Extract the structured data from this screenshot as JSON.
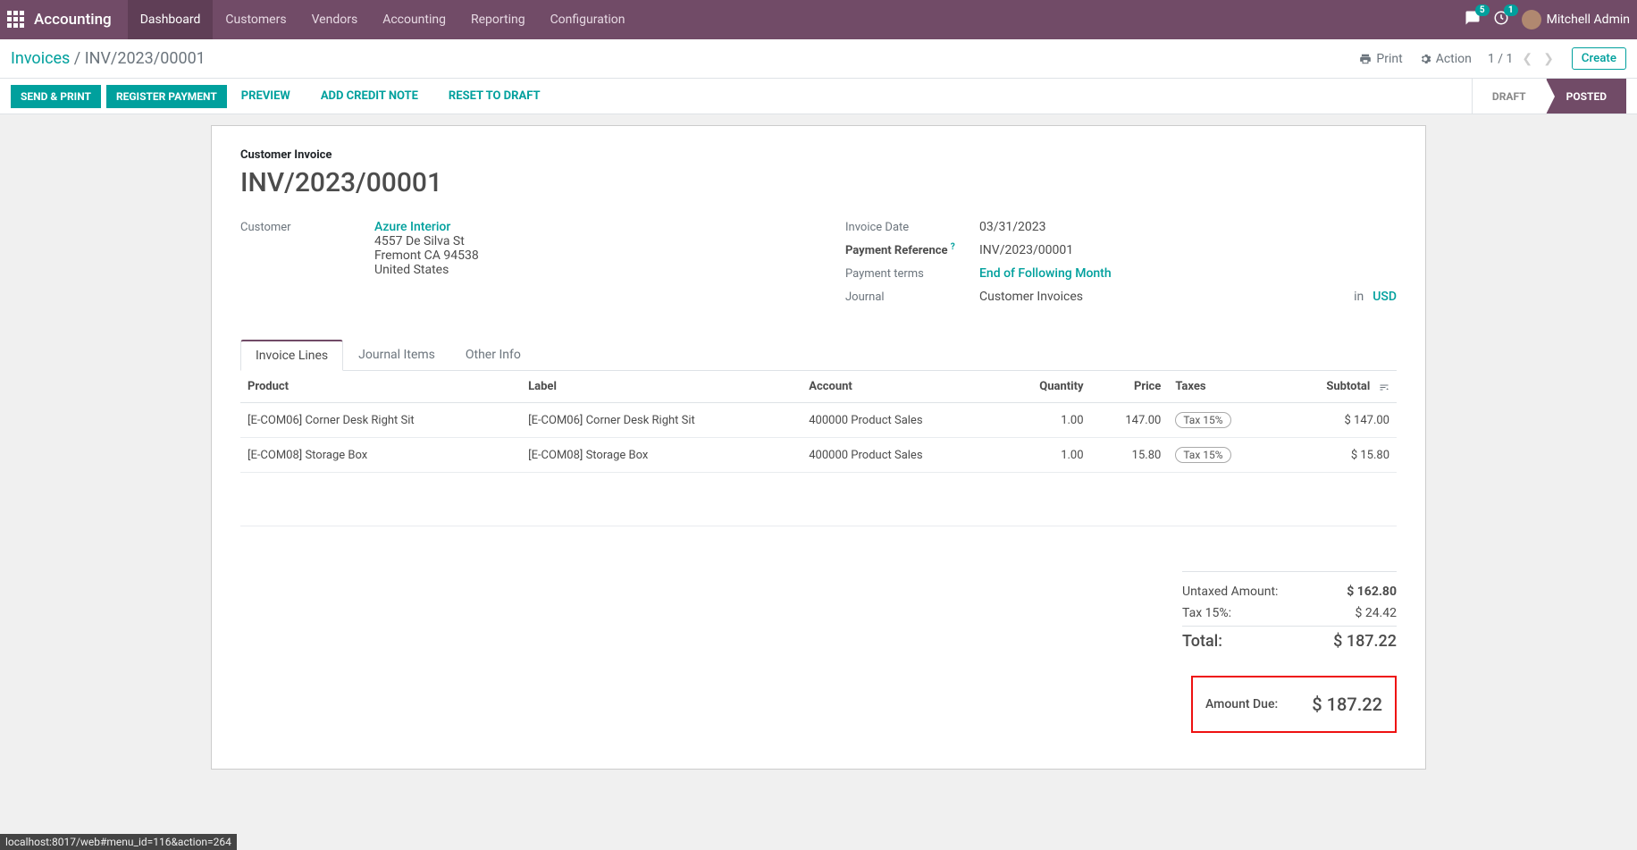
{
  "nav": {
    "brand": "Accounting",
    "items": [
      "Dashboard",
      "Customers",
      "Vendors",
      "Accounting",
      "Reporting",
      "Configuration"
    ],
    "activeIndex": 0,
    "messagesBadge": "5",
    "activitiesBadge": "1",
    "user": "Mitchell Admin"
  },
  "controlBar": {
    "breadcrumbRoot": "Invoices",
    "breadcrumbCurrent": "INV/2023/00001",
    "printLabel": "Print",
    "actionLabel": "Action",
    "pager": "1 / 1",
    "createLabel": "Create"
  },
  "statusBar": {
    "buttons": {
      "sendPrint": "SEND & PRINT",
      "registerPayment": "REGISTER PAYMENT",
      "preview": "PREVIEW",
      "addCreditNote": "ADD CREDIT NOTE",
      "resetDraft": "RESET TO DRAFT"
    },
    "states": {
      "draft": "DRAFT",
      "posted": "POSTED"
    }
  },
  "sheet": {
    "typeLabel": "Customer Invoice",
    "title": "INV/2023/00001",
    "left": {
      "customerLabel": "Customer",
      "customerName": "Azure Interior",
      "addr1": "4557 De Silva St",
      "addr2": "Fremont CA 94538",
      "addr3": "United States"
    },
    "right": {
      "invoiceDateLabel": "Invoice Date",
      "invoiceDate": "03/31/2023",
      "payRefLabel": "Payment Reference",
      "payRef": "INV/2023/00001",
      "payTermsLabel": "Payment terms",
      "payTerms": "End of Following Month",
      "journalLabel": "Journal",
      "journal": "Customer Invoices",
      "inLabel": "in",
      "currency": "USD"
    }
  },
  "tabs": [
    "Invoice Lines",
    "Journal Items",
    "Other Info"
  ],
  "tableHeaders": {
    "product": "Product",
    "label": "Label",
    "account": "Account",
    "qty": "Quantity",
    "price": "Price",
    "taxes": "Taxes",
    "subtotal": "Subtotal"
  },
  "lines": [
    {
      "product": "[E-COM06] Corner Desk Right Sit",
      "label": "[E-COM06] Corner Desk Right Sit",
      "account": "400000 Product Sales",
      "qty": "1.00",
      "price": "147.00",
      "tax": "Tax 15%",
      "subtotal": "$ 147.00"
    },
    {
      "product": "[E-COM08] Storage Box",
      "label": "[E-COM08] Storage Box",
      "account": "400000 Product Sales",
      "qty": "1.00",
      "price": "15.80",
      "tax": "Tax 15%",
      "subtotal": "$ 15.80"
    }
  ],
  "totals": {
    "untaxedLabel": "Untaxed Amount:",
    "untaxed": "$ 162.80",
    "taxLabel": "Tax 15%:",
    "tax": "$ 24.42",
    "totalLabel": "Total:",
    "total": "$ 187.22",
    "dueLabel": "Amount Due:",
    "due": "$ 187.22"
  },
  "statusline": "localhost:8017/web#menu_id=116&action=264"
}
